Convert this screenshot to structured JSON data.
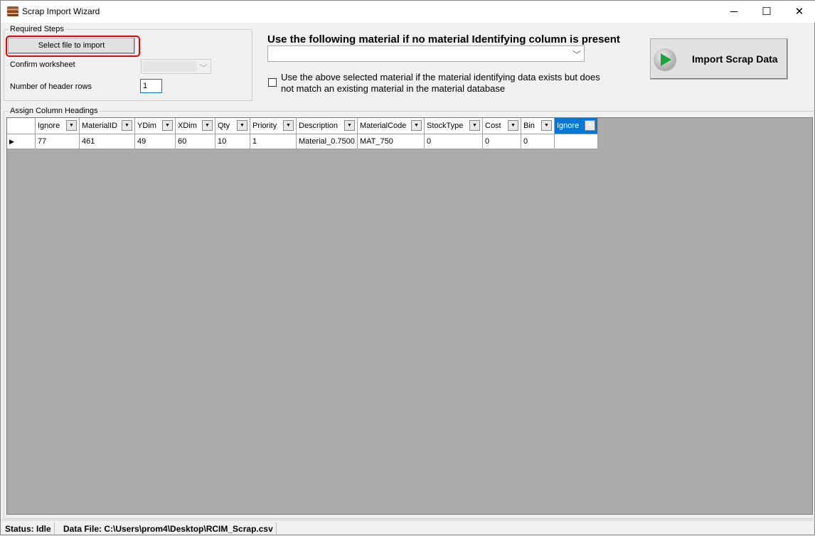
{
  "window": {
    "title": "Scrap Import Wizard",
    "controls": {
      "minimize": "─",
      "maximize": "☐",
      "close": "✕"
    }
  },
  "required_steps": {
    "legend": "Required Steps",
    "select_file": "Select file to import",
    "confirm_worksheet": "Confirm worksheet",
    "worksheet_value": "",
    "header_rows_label": "Number of header rows",
    "header_rows": "1"
  },
  "material": {
    "heading": "Use the following material if no material Identifying column is present",
    "selected": "",
    "checkbox_label": "Use the above selected material if the material identifying data exists but does not match an existing material in the material database",
    "checked": false
  },
  "import_button": {
    "label": "Import Scrap Data",
    "icon": "play-icon"
  },
  "grid": {
    "legend": "Assign Column Headings",
    "columns": [
      "Ignore",
      "MaterialID",
      "YDim",
      "XDim",
      "Qty",
      "Priority",
      "Description",
      "MaterialCode",
      "StockType",
      "Cost",
      "Bin",
      "Ignore"
    ],
    "selected_column": 11,
    "rows": [
      [
        "77",
        "461",
        "49",
        "60",
        "10",
        "1",
        "Material_0.7500",
        "MAT_750",
        "0",
        "0",
        "0",
        ""
      ]
    ]
  },
  "status": {
    "status": "Status: Idle",
    "data_file": "Data File: C:\\Users\\prom4\\Desktop\\RCIM_Scrap.csv"
  }
}
